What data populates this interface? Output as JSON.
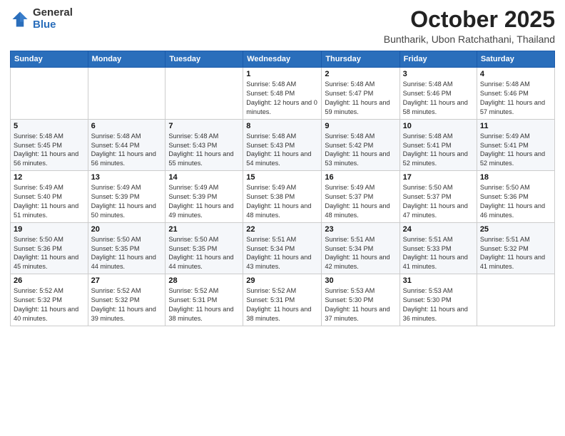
{
  "logo": {
    "general": "General",
    "blue": "Blue"
  },
  "header": {
    "month": "October 2025",
    "location": "Buntharik, Ubon Ratchathani, Thailand"
  },
  "weekdays": [
    "Sunday",
    "Monday",
    "Tuesday",
    "Wednesday",
    "Thursday",
    "Friday",
    "Saturday"
  ],
  "weeks": [
    [
      {
        "day": "",
        "sunrise": "",
        "sunset": "",
        "daylight": ""
      },
      {
        "day": "",
        "sunrise": "",
        "sunset": "",
        "daylight": ""
      },
      {
        "day": "",
        "sunrise": "",
        "sunset": "",
        "daylight": ""
      },
      {
        "day": "1",
        "sunrise": "Sunrise: 5:48 AM",
        "sunset": "Sunset: 5:48 PM",
        "daylight": "Daylight: 12 hours and 0 minutes."
      },
      {
        "day": "2",
        "sunrise": "Sunrise: 5:48 AM",
        "sunset": "Sunset: 5:47 PM",
        "daylight": "Daylight: 11 hours and 59 minutes."
      },
      {
        "day": "3",
        "sunrise": "Sunrise: 5:48 AM",
        "sunset": "Sunset: 5:46 PM",
        "daylight": "Daylight: 11 hours and 58 minutes."
      },
      {
        "day": "4",
        "sunrise": "Sunrise: 5:48 AM",
        "sunset": "Sunset: 5:46 PM",
        "daylight": "Daylight: 11 hours and 57 minutes."
      }
    ],
    [
      {
        "day": "5",
        "sunrise": "Sunrise: 5:48 AM",
        "sunset": "Sunset: 5:45 PM",
        "daylight": "Daylight: 11 hours and 56 minutes."
      },
      {
        "day": "6",
        "sunrise": "Sunrise: 5:48 AM",
        "sunset": "Sunset: 5:44 PM",
        "daylight": "Daylight: 11 hours and 56 minutes."
      },
      {
        "day": "7",
        "sunrise": "Sunrise: 5:48 AM",
        "sunset": "Sunset: 5:43 PM",
        "daylight": "Daylight: 11 hours and 55 minutes."
      },
      {
        "day": "8",
        "sunrise": "Sunrise: 5:48 AM",
        "sunset": "Sunset: 5:43 PM",
        "daylight": "Daylight: 11 hours and 54 minutes."
      },
      {
        "day": "9",
        "sunrise": "Sunrise: 5:48 AM",
        "sunset": "Sunset: 5:42 PM",
        "daylight": "Daylight: 11 hours and 53 minutes."
      },
      {
        "day": "10",
        "sunrise": "Sunrise: 5:48 AM",
        "sunset": "Sunset: 5:41 PM",
        "daylight": "Daylight: 11 hours and 52 minutes."
      },
      {
        "day": "11",
        "sunrise": "Sunrise: 5:49 AM",
        "sunset": "Sunset: 5:41 PM",
        "daylight": "Daylight: 11 hours and 52 minutes."
      }
    ],
    [
      {
        "day": "12",
        "sunrise": "Sunrise: 5:49 AM",
        "sunset": "Sunset: 5:40 PM",
        "daylight": "Daylight: 11 hours and 51 minutes."
      },
      {
        "day": "13",
        "sunrise": "Sunrise: 5:49 AM",
        "sunset": "Sunset: 5:39 PM",
        "daylight": "Daylight: 11 hours and 50 minutes."
      },
      {
        "day": "14",
        "sunrise": "Sunrise: 5:49 AM",
        "sunset": "Sunset: 5:39 PM",
        "daylight": "Daylight: 11 hours and 49 minutes."
      },
      {
        "day": "15",
        "sunrise": "Sunrise: 5:49 AM",
        "sunset": "Sunset: 5:38 PM",
        "daylight": "Daylight: 11 hours and 48 minutes."
      },
      {
        "day": "16",
        "sunrise": "Sunrise: 5:49 AM",
        "sunset": "Sunset: 5:37 PM",
        "daylight": "Daylight: 11 hours and 48 minutes."
      },
      {
        "day": "17",
        "sunrise": "Sunrise: 5:50 AM",
        "sunset": "Sunset: 5:37 PM",
        "daylight": "Daylight: 11 hours and 47 minutes."
      },
      {
        "day": "18",
        "sunrise": "Sunrise: 5:50 AM",
        "sunset": "Sunset: 5:36 PM",
        "daylight": "Daylight: 11 hours and 46 minutes."
      }
    ],
    [
      {
        "day": "19",
        "sunrise": "Sunrise: 5:50 AM",
        "sunset": "Sunset: 5:36 PM",
        "daylight": "Daylight: 11 hours and 45 minutes."
      },
      {
        "day": "20",
        "sunrise": "Sunrise: 5:50 AM",
        "sunset": "Sunset: 5:35 PM",
        "daylight": "Daylight: 11 hours and 44 minutes."
      },
      {
        "day": "21",
        "sunrise": "Sunrise: 5:50 AM",
        "sunset": "Sunset: 5:35 PM",
        "daylight": "Daylight: 11 hours and 44 minutes."
      },
      {
        "day": "22",
        "sunrise": "Sunrise: 5:51 AM",
        "sunset": "Sunset: 5:34 PM",
        "daylight": "Daylight: 11 hours and 43 minutes."
      },
      {
        "day": "23",
        "sunrise": "Sunrise: 5:51 AM",
        "sunset": "Sunset: 5:34 PM",
        "daylight": "Daylight: 11 hours and 42 minutes."
      },
      {
        "day": "24",
        "sunrise": "Sunrise: 5:51 AM",
        "sunset": "Sunset: 5:33 PM",
        "daylight": "Daylight: 11 hours and 41 minutes."
      },
      {
        "day": "25",
        "sunrise": "Sunrise: 5:51 AM",
        "sunset": "Sunset: 5:32 PM",
        "daylight": "Daylight: 11 hours and 41 minutes."
      }
    ],
    [
      {
        "day": "26",
        "sunrise": "Sunrise: 5:52 AM",
        "sunset": "Sunset: 5:32 PM",
        "daylight": "Daylight: 11 hours and 40 minutes."
      },
      {
        "day": "27",
        "sunrise": "Sunrise: 5:52 AM",
        "sunset": "Sunset: 5:32 PM",
        "daylight": "Daylight: 11 hours and 39 minutes."
      },
      {
        "day": "28",
        "sunrise": "Sunrise: 5:52 AM",
        "sunset": "Sunset: 5:31 PM",
        "daylight": "Daylight: 11 hours and 38 minutes."
      },
      {
        "day": "29",
        "sunrise": "Sunrise: 5:52 AM",
        "sunset": "Sunset: 5:31 PM",
        "daylight": "Daylight: 11 hours and 38 minutes."
      },
      {
        "day": "30",
        "sunrise": "Sunrise: 5:53 AM",
        "sunset": "Sunset: 5:30 PM",
        "daylight": "Daylight: 11 hours and 37 minutes."
      },
      {
        "day": "31",
        "sunrise": "Sunrise: 5:53 AM",
        "sunset": "Sunset: 5:30 PM",
        "daylight": "Daylight: 11 hours and 36 minutes."
      },
      {
        "day": "",
        "sunrise": "",
        "sunset": "",
        "daylight": ""
      }
    ]
  ]
}
